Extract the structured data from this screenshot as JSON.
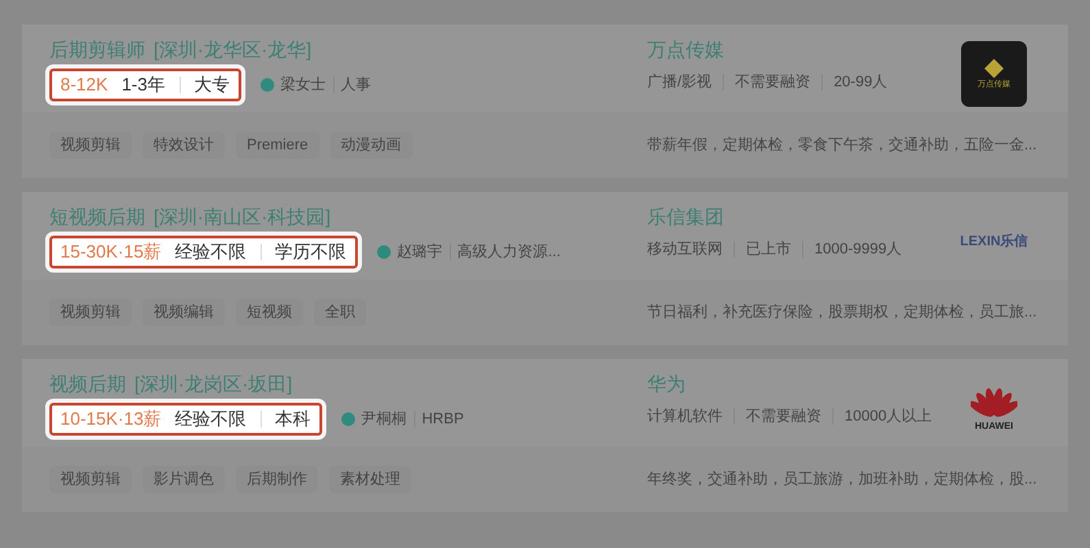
{
  "jobs": [
    {
      "title": "后期剪辑师",
      "location": "[深圳·龙华区·龙华]",
      "salary": "8-12K",
      "experience": "1-3年",
      "education": "大专",
      "recruiter": {
        "name": "梁女士",
        "role": "人事",
        "color": "#2e8b7e"
      },
      "tags": [
        "视频剪辑",
        "特效设计",
        "Premiere",
        "动漫动画"
      ],
      "company": {
        "name": "万点传媒",
        "industry": "广播/影视",
        "funding": "不需要融资",
        "size": "20-99人",
        "benefits": "带薪年假，定期体检，零食下午茶，交通补助，五险一金...",
        "logo": {
          "kind": "square",
          "text": "万点传媒"
        }
      }
    },
    {
      "title": "短视频后期",
      "location": "[深圳·南山区·科技园]",
      "salary": "15-30K·15薪",
      "experience": "经验不限",
      "education": "学历不限",
      "recruiter": {
        "name": "赵璐宇",
        "role": "高级人力资源...",
        "color": "#2e8b7e"
      },
      "tags": [
        "视频剪辑",
        "视频编辑",
        "短视频",
        "全职"
      ],
      "company": {
        "name": "乐信集团",
        "industry": "移动互联网",
        "funding": "已上市",
        "size": "1000-9999人",
        "benefits": "节日福利，补充医疗保险，股票期权，定期体检，员工旅...",
        "logo": {
          "kind": "wordmark",
          "text": "LEXIN乐信"
        }
      }
    },
    {
      "title": "视频后期",
      "location": "[深圳·龙岗区·坂田]",
      "salary": "10-15K·13薪",
      "experience": "经验不限",
      "education": "本科",
      "recruiter": {
        "name": "尹桐桐",
        "role": "HRBP",
        "color": "#2e8b7e"
      },
      "tags": [
        "视频剪辑",
        "影片调色",
        "后期制作",
        "素材处理"
      ],
      "company": {
        "name": "华为",
        "industry": "计算机软件",
        "funding": "不需要融资",
        "size": "10000人以上",
        "benefits": "年终奖，交通补助，员工旅游，加班补助，定期体检，股...",
        "logo": {
          "kind": "petals",
          "text": "HUAWEI"
        }
      }
    }
  ]
}
